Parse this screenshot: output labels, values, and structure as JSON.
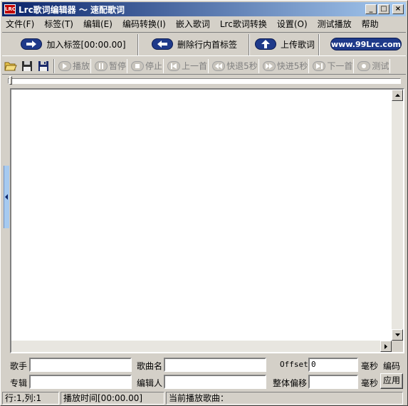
{
  "window": {
    "icon_text": "LRC",
    "title": "Lrc歌词编辑器 ～ 速配歌词",
    "controls": [
      "_",
      "□",
      "×"
    ]
  },
  "menu": [
    "文件(F)",
    "标签(T)",
    "编辑(E)",
    "编码转换(I)",
    "嵌入歌词",
    "Lrc歌词转换",
    "设置(O)",
    "测试播放",
    "帮助"
  ],
  "big_buttons": {
    "add_tag": "加入标签[00:00.00]",
    "delete_tag": "删除行内首标签",
    "upload": "上传歌词",
    "brand": "www.99Lrc.com"
  },
  "toolbar": {
    "icons": [
      "open-folder-icon",
      "save-icon",
      "save-as-icon"
    ],
    "play": "播放",
    "pause": "暂停",
    "stop": "停止",
    "prev": "上一首",
    "rewind": "快退5秒",
    "forward": "快进5秒",
    "next": "下一首",
    "test": "测试"
  },
  "form": {
    "artist_label": "歌手",
    "artist_value": "",
    "title_label": "歌曲名",
    "title_value": "",
    "offset_label": "Offset",
    "offset_value": "0",
    "offset_unit": "毫秒",
    "encoding_label": "编码",
    "album_label": "专辑",
    "album_value": "",
    "editor_label": "编辑人",
    "editor_value": "",
    "shift_label": "整体偏移",
    "shift_value": "",
    "shift_unit": "毫秒",
    "apply_label": "应用"
  },
  "status": {
    "position": "行:1,列:1",
    "play_time": "播放时间[00:00.00]",
    "current_song": "当前播放歌曲："
  },
  "colors": {
    "title_start": "#0a246a",
    "title_end": "#a6caf0",
    "face": "#d4d0c8",
    "brand": "#1f3a8a"
  }
}
